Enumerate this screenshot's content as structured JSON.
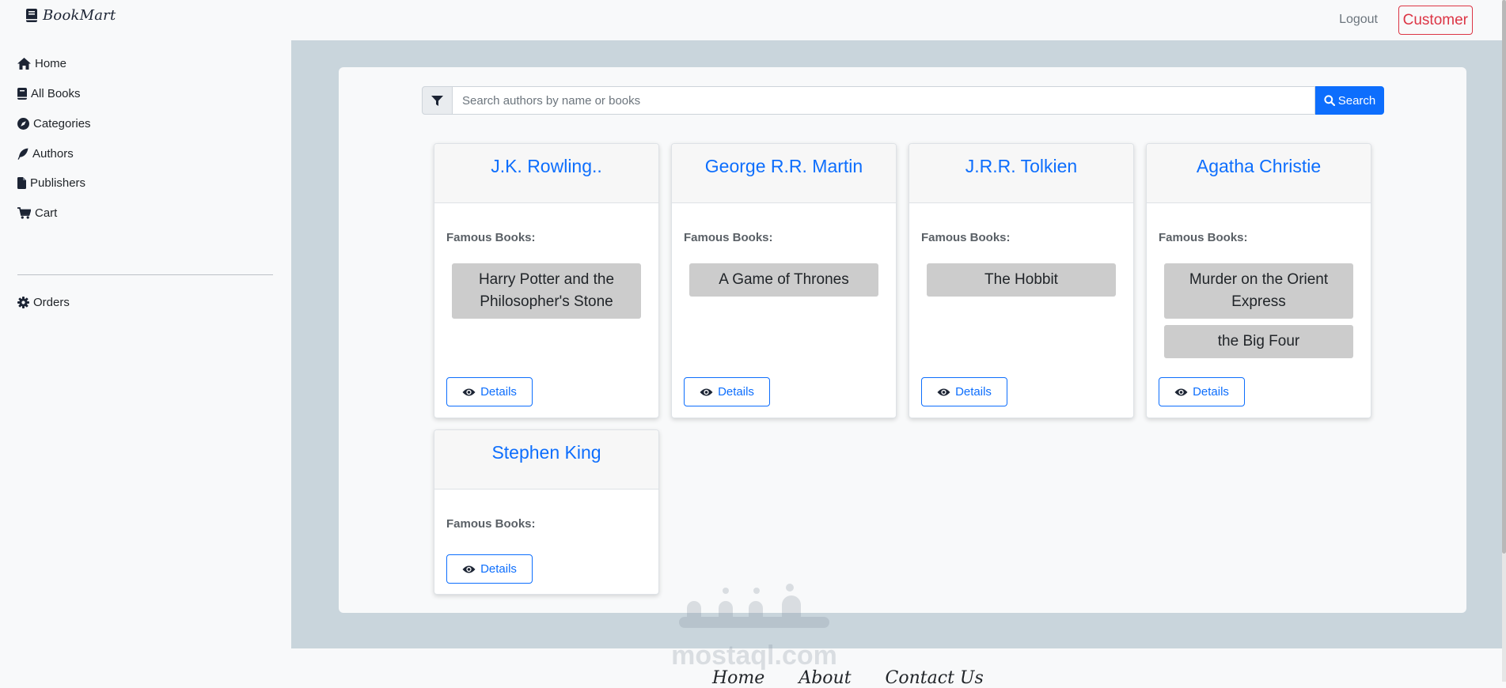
{
  "brand": {
    "name": "BookMart",
    "icon": "book-icon"
  },
  "topbar": {
    "logout_label": "Logout",
    "role_label": "Customer"
  },
  "sidebar": {
    "items": [
      {
        "label": "Home",
        "icon": "home-icon"
      },
      {
        "label": "All Books",
        "icon": "book-icon"
      },
      {
        "label": "Categories",
        "icon": "compass-icon"
      },
      {
        "label": "Authors",
        "icon": "feather-icon"
      },
      {
        "label": "Publishers",
        "icon": "file-icon"
      },
      {
        "label": "Cart",
        "icon": "cart-icon"
      }
    ],
    "secondary_items": [
      {
        "label": "Orders",
        "icon": "gear-icon"
      }
    ]
  },
  "search": {
    "placeholder": "Search authors by name or books",
    "value": "",
    "button_label": "Search",
    "filter_icon": "filter-icon"
  },
  "famous_books_label": "Famous Books:",
  "details_label": "Details",
  "authors": [
    {
      "name": "J.K. Rowling..",
      "books": [
        "Harry Potter and the Philosopher's Stone"
      ]
    },
    {
      "name": "George R.R. Martin",
      "books": [
        "A Game of Thrones"
      ]
    },
    {
      "name": "J.R.R. Tolkien",
      "books": [
        "The Hobbit"
      ]
    },
    {
      "name": "Agatha Christie",
      "books": [
        "Murder on the Orient Express",
        "the Big Four"
      ]
    },
    {
      "name": "Stephen King",
      "books": []
    }
  ],
  "footer": {
    "links": [
      "Home",
      "About",
      "Contact Us"
    ]
  },
  "watermark": {
    "text": "mostaql.com"
  },
  "colors": {
    "primary": "#0d6efd",
    "danger": "#dc3545",
    "main_background": "#c9d5dc",
    "chip_background": "#cccccc"
  }
}
